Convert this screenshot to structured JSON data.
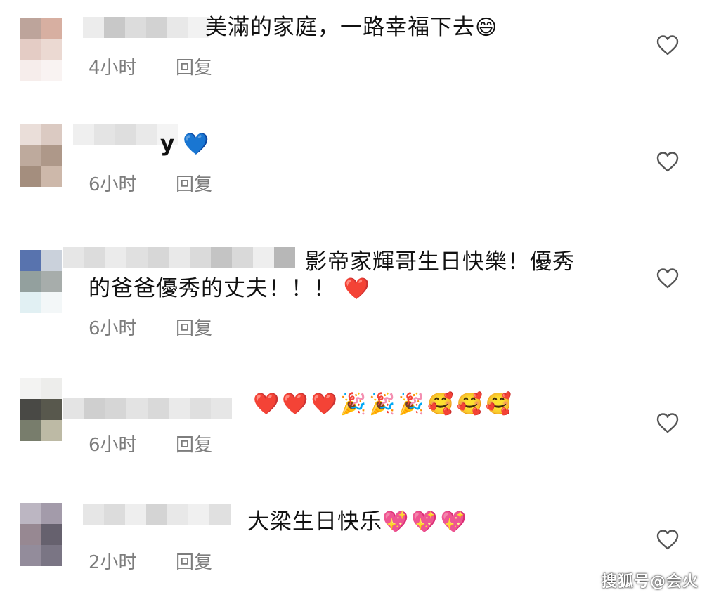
{
  "comments": [
    {
      "text": "美滿的家庭，一路幸福下去",
      "emoji": "😄",
      "time": "4小时",
      "reply": "回复"
    },
    {
      "text": "y",
      "emoji": "💙",
      "time": "6小时",
      "reply": "回复"
    },
    {
      "text_line1": "影帝家輝哥生日快樂！優秀",
      "text_line2": "的爸爸優秀的丈夫！！！",
      "emoji": "❤️",
      "time": "6小时",
      "reply": "回复"
    },
    {
      "emoji_text": "❤️❤️❤️🎉🎉🎉🥰🥰🥰",
      "time": "6小时",
      "reply": "回复"
    },
    {
      "text": "大梁生日快乐",
      "emoji": "💖💖💖",
      "time": "2小时",
      "reply": "回复"
    }
  ],
  "watermark": "搜狐号@会火",
  "icons": {
    "like": "heart-outline-icon"
  },
  "colors": {
    "meta_text": "#7d7d7d",
    "heart_stroke": "#555555"
  }
}
